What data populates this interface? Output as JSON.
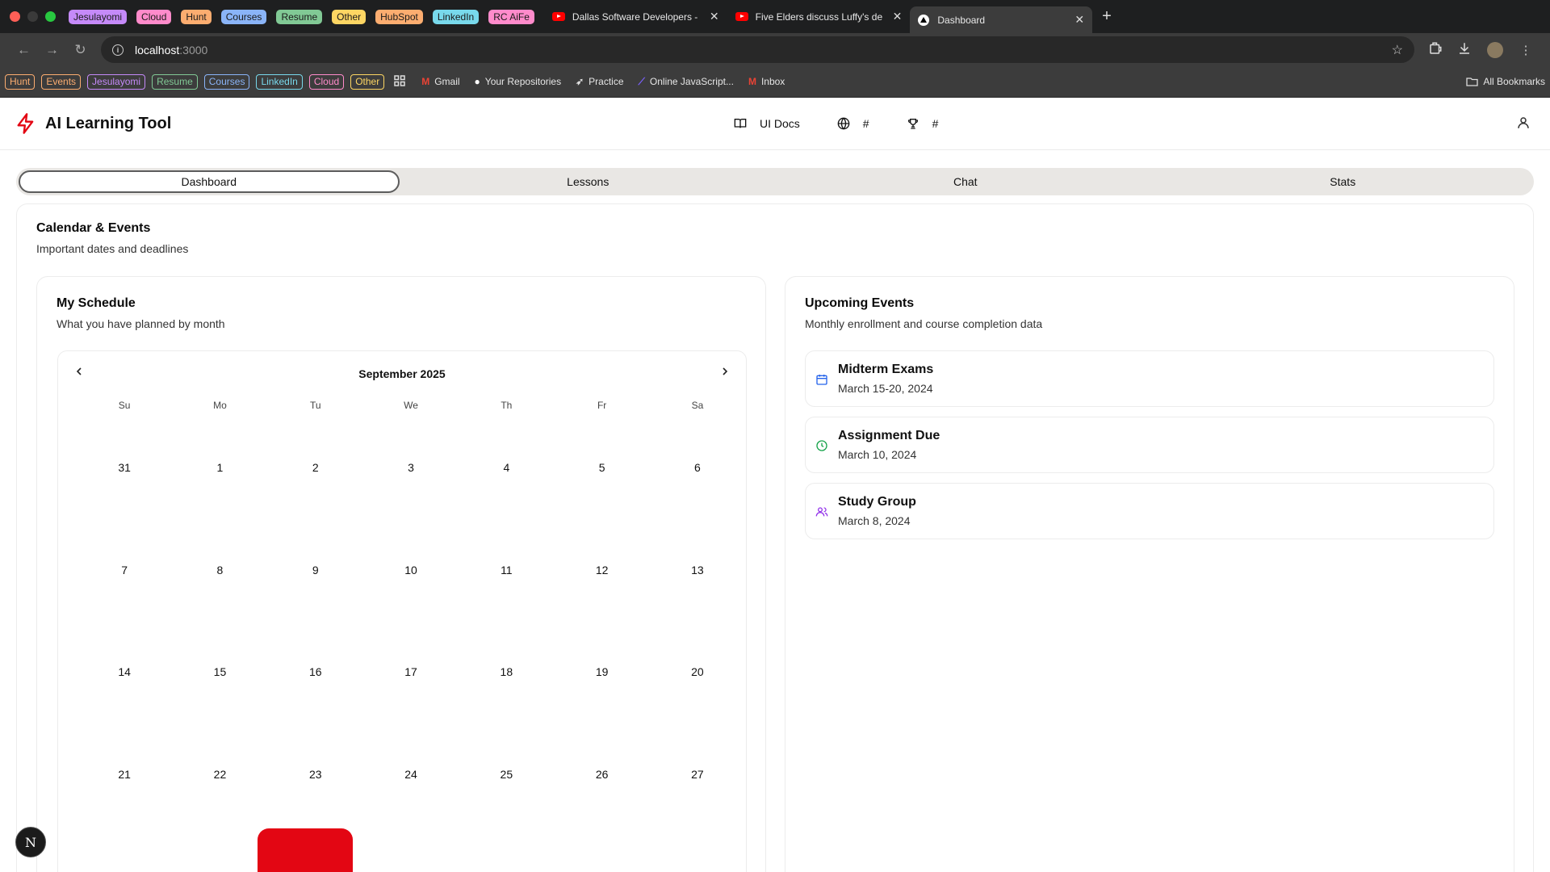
{
  "browser": {
    "tab_groups": [
      {
        "label": "Jesulayomi",
        "color": "#c58af9"
      },
      {
        "label": "Cloud",
        "color": "#ff8bcb"
      },
      {
        "label": "Hunt",
        "color": "#fcad70"
      },
      {
        "label": "Courses",
        "color": "#8ab4f8"
      },
      {
        "label": "Resume",
        "color": "#81c995"
      },
      {
        "label": "Other",
        "color": "#fdd663"
      },
      {
        "label": "HubSpot",
        "color": "#fcad70"
      },
      {
        "label": "LinkedIn",
        "color": "#78d9ec"
      },
      {
        "label": "RC AiFe",
        "color": "#ff8bcb"
      }
    ],
    "tabs": [
      {
        "title": "Dallas Software Developers -",
        "favicon": "youtube-icon"
      },
      {
        "title": "Five Elders discuss Luffy's de",
        "favicon": "youtube-icon"
      },
      {
        "title": "Dashboard",
        "favicon": "vercel-icon",
        "active": true
      }
    ],
    "url_host": "localhost",
    "url_port": ":3000",
    "bookmark_groups": [
      {
        "label": "Hunt",
        "color": "#fcad70"
      },
      {
        "label": "Events",
        "color": "#fcad70"
      },
      {
        "label": "Jesulayomi",
        "color": "#c58af9"
      },
      {
        "label": "Resume",
        "color": "#81c995"
      },
      {
        "label": "Courses",
        "color": "#8ab4f8"
      },
      {
        "label": "LinkedIn",
        "color": "#78d9ec"
      },
      {
        "label": "Cloud",
        "color": "#ff8bcb"
      },
      {
        "label": "Other",
        "color": "#fdd663"
      }
    ],
    "bookmarks": [
      {
        "label": "Gmail",
        "icon": "gmail-icon"
      },
      {
        "label": "Your Repositories",
        "icon": "github-icon"
      },
      {
        "label": "Practice",
        "icon": "rocket-icon"
      },
      {
        "label": "Online JavaScript...",
        "icon": "code-icon"
      },
      {
        "label": "Inbox",
        "icon": "gmail-icon"
      }
    ],
    "all_bookmarks": "All Bookmarks"
  },
  "app": {
    "brand": "AI Learning Tool",
    "brand_color": "#e30613",
    "nav": [
      {
        "label": "UI Docs",
        "icon": "book-icon"
      },
      {
        "label": "#",
        "icon": "globe-icon"
      },
      {
        "label": "#",
        "icon": "trophy-icon"
      }
    ],
    "tabs": [
      "Dashboard",
      "Lessons",
      "Chat",
      "Stats"
    ],
    "active_tab": "Dashboard",
    "section": {
      "title": "Calendar & Events",
      "subtitle": "Important dates and deadlines"
    },
    "schedule": {
      "title": "My Schedule",
      "subtitle": "What you have planned by month",
      "month": "September 2025",
      "weekdays": [
        "Su",
        "Mo",
        "Tu",
        "We",
        "Th",
        "Fr",
        "Sa"
      ],
      "weeks": [
        [
          "31",
          "1",
          "2",
          "3",
          "4",
          "5",
          "6"
        ],
        [
          "7",
          "8",
          "9",
          "10",
          "11",
          "12",
          "13"
        ],
        [
          "14",
          "15",
          "16",
          "17",
          "18",
          "19",
          "20"
        ],
        [
          "21",
          "22",
          "23",
          "24",
          "25",
          "26",
          "27"
        ]
      ],
      "today_color": "#e30613"
    },
    "events": {
      "title": "Upcoming Events",
      "subtitle": "Monthly enrollment and course completion data",
      "items": [
        {
          "name": "Midterm Exams",
          "date": "March 15-20, 2024",
          "icon": "calendar-icon",
          "color": "#2563eb"
        },
        {
          "name": "Assignment Due",
          "date": "March 10, 2024",
          "icon": "clock-icon",
          "color": "#16a34a"
        },
        {
          "name": "Study Group",
          "date": "March 8, 2024",
          "icon": "users-icon",
          "color": "#9333ea"
        }
      ]
    },
    "dev_badge": "N"
  }
}
